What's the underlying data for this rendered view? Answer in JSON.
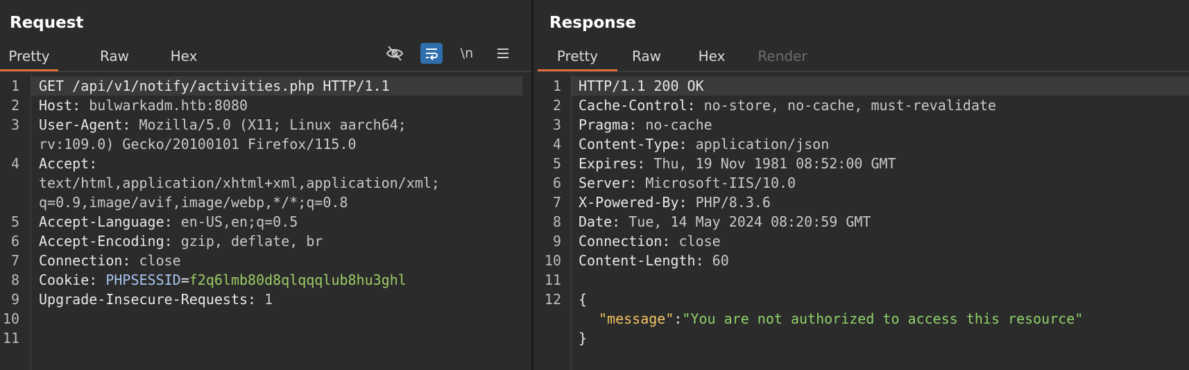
{
  "request": {
    "title": "Request",
    "tabs": [
      {
        "label": "Pretty"
      },
      {
        "label": "Raw"
      },
      {
        "label": "Hex"
      }
    ],
    "toolbar": {
      "newline_label": "\\n"
    },
    "line_numbers": [
      "1",
      "2",
      "3",
      "4",
      "5",
      "6",
      "7",
      "8",
      "9",
      "10",
      "11"
    ],
    "lines": {
      "l1": "GET /api/v1/notify/activities.php HTTP/1.1",
      "l2k": "Host:",
      "l2v": "bulwarkadm.htb:8080",
      "l3k": "User-Agent:",
      "l3v": "Mozilla/5.0 (X11; Linux aarch64;",
      "l3w": "rv:109.0) Gecko/20100101 Firefox/115.0",
      "l4k": "Accept:",
      "l4w1": "text/html,application/xhtml+xml,application/xml;",
      "l4w2": "q=0.9,image/avif,image/webp,*/*;q=0.8",
      "l5k": "Accept-Language:",
      "l5v": "en-US,en;q=0.5",
      "l6k": "Accept-Encoding:",
      "l6v": "gzip, deflate, br",
      "l7k": "Connection:",
      "l7v": "close",
      "l8k": "Cookie:",
      "l8ck": "PHPSESSID",
      "l8eq": "=",
      "l8cv": "f2q6lmb80d8qlqqqlub8hu3ghl",
      "l9k": "Upgrade-Insecure-Requests:",
      "l9v": "1"
    }
  },
  "response": {
    "title": "Response",
    "tabs": [
      {
        "label": "Pretty"
      },
      {
        "label": "Raw"
      },
      {
        "label": "Hex"
      },
      {
        "label": "Render"
      }
    ],
    "line_numbers": [
      "1",
      "2",
      "3",
      "4",
      "5",
      "6",
      "7",
      "8",
      "9",
      "10",
      "11",
      "12"
    ],
    "lines": {
      "l1": "HTTP/1.1 200 OK",
      "l2k": "Cache-Control:",
      "l2v": "no-store, no-cache, must-revalidate",
      "l3k": "Pragma:",
      "l3v": "no-cache",
      "l4k": "Content-Type:",
      "l4v": "application/json",
      "l5k": "Expires:",
      "l5v": "Thu, 19 Nov 1981 08:52:00 GMT",
      "l6k": "Server:",
      "l6v": "Microsoft-IIS/10.0",
      "l7k": "X-Powered-By:",
      "l7v": "PHP/8.3.6",
      "l8k": "Date:",
      "l8v": "Tue, 14 May 2024 08:20:59 GMT",
      "l9k": "Connection:",
      "l9v": "close",
      "l10k": "Content-Length:",
      "l10v": "60",
      "l12": "{",
      "json_key": "\"message\"",
      "json_colon": ":",
      "json_val": "\"You are not authorized to access this resource\"",
      "json_close": "}"
    }
  },
  "colors": {
    "accent_tab": "#e06e3c",
    "wrap_button": "#2f6fae",
    "cookie_name": "#a9c4ee",
    "cookie_value": "#9ccc65",
    "json_key": "#f3c461",
    "json_string": "#8fd16a"
  },
  "icons": [
    "eye-slash-icon",
    "wrap-lines-icon",
    "newline-icon",
    "menu-icon"
  ]
}
